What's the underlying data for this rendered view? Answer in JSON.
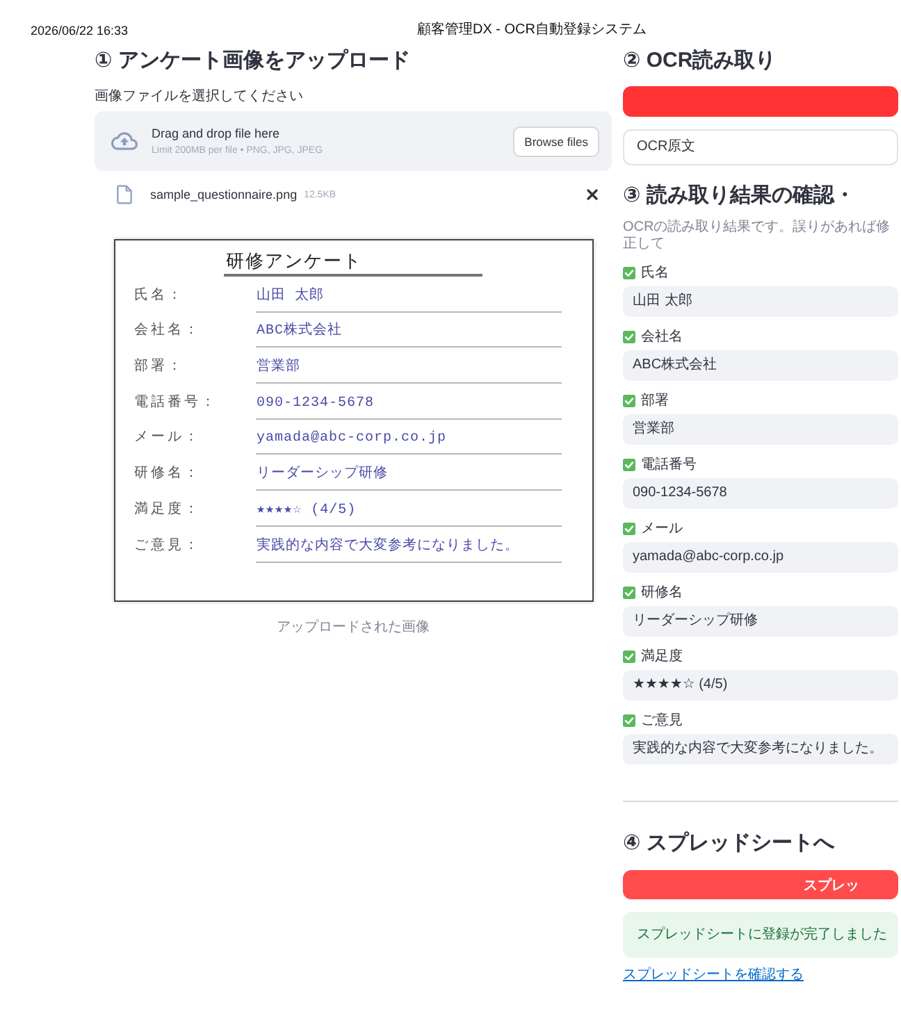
{
  "print_header": {
    "date": "2026/06/22 16:33",
    "title": "顧客管理DX - OCR自動登録システム"
  },
  "upload": {
    "heading": "① アンケート画像をアップロード",
    "label": "画像ファイルを選択してください",
    "dropzone": {
      "title": "Drag and drop file here",
      "hint": "Limit 200MB per file • PNG, JPG, JPEG",
      "button": "Browse files"
    },
    "files": [
      {
        "name": "sample_questionnaire.png",
        "size": "12.5KB"
      }
    ],
    "image": {
      "title": "研修アンケート",
      "rows": [
        {
          "label": "氏名：",
          "value": "山田 太郎"
        },
        {
          "label": "会社名：",
          "value": "ABC株式会社"
        },
        {
          "label": "部署：",
          "value": "営業部"
        },
        {
          "label": "電話番号：",
          "value": "090-1234-5678"
        },
        {
          "label": "メール：",
          "value": "yamada@abc-corp.co.jp"
        },
        {
          "label": "研修名：",
          "value": "リーダーシップ研修"
        },
        {
          "label": "満足度：",
          "value": "★★★★☆ (4/5)"
        },
        {
          "label": "ご意見：",
          "value": "実践的な内容で大変参考になりました。"
        }
      ]
    },
    "caption": "アップロードされた画像"
  },
  "ocr": {
    "heading": "② OCR読み取り",
    "expander": {
      "label": "OCR原文"
    }
  },
  "review": {
    "heading": "③ 読み取り結果の確認・",
    "description": "OCRの読み取り結果です。誤りがあれば修正して",
    "fields": [
      {
        "label": "氏名",
        "value": "山田 太郎"
      },
      {
        "label": "会社名",
        "value": "ABC株式会社"
      },
      {
        "label": "部署",
        "value": "営業部"
      },
      {
        "label": "電話番号",
        "value": "090-1234-5678"
      },
      {
        "label": "メール",
        "value": "yamada@abc-corp.co.jp"
      },
      {
        "label": "研修名",
        "value": "リーダーシップ研修"
      },
      {
        "label": "満足度",
        "value": "★★★★☆ (4/5)"
      },
      {
        "label": "ご意見",
        "value": "実践的な内容で大変参考になりました。"
      }
    ]
  },
  "register": {
    "heading": "④ スプレッドシートへ",
    "button": "スプレッ",
    "success": "スプレッドシートに登録が完了しました",
    "link": "スプレッドシートを確認する"
  }
}
